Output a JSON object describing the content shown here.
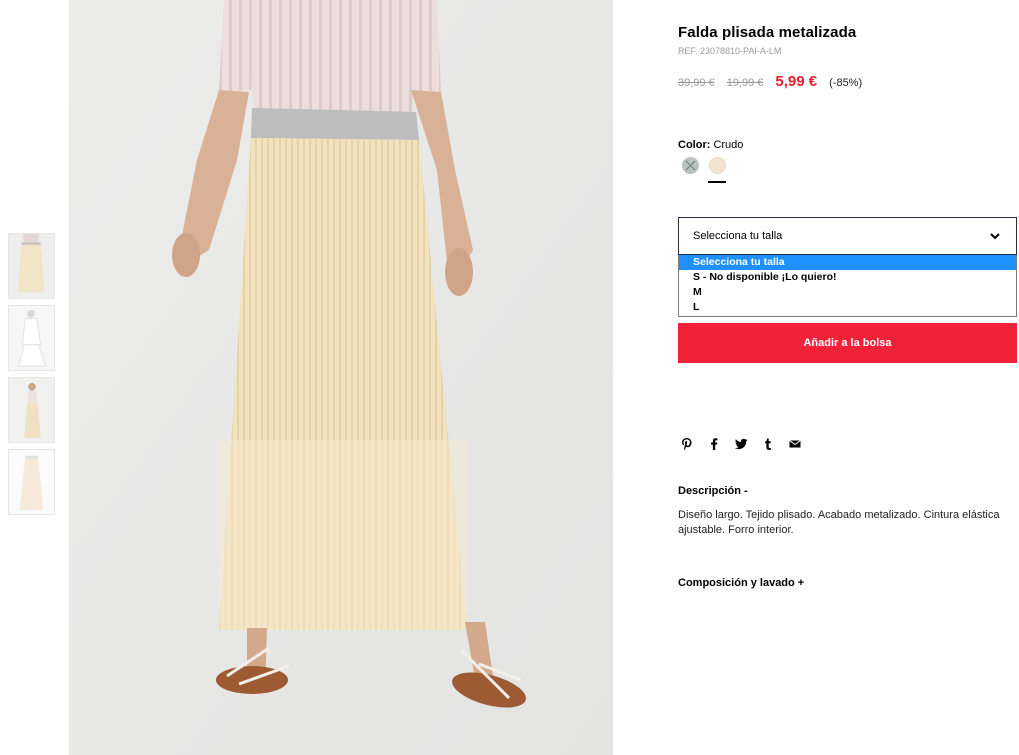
{
  "product": {
    "title": "Falda plisada metalizada",
    "ref": "REF. 23078810-PAI-A-LM",
    "price_original": "39,99 €",
    "price_previous": "19,99 €",
    "price_sale": "5,99 €",
    "discount": "(-85%)"
  },
  "color": {
    "label": "Color:",
    "value": "Crudo",
    "swatches": [
      "grey-pattern",
      "crudo"
    ]
  },
  "size": {
    "placeholder": "Selecciona tu talla",
    "options": [
      "Selecciona tu talla",
      "S - No disponible ¡Lo quiero!",
      "M",
      "L"
    ],
    "highlighted_option": "Selecciona tu talla"
  },
  "actions": {
    "add_to_bag": "Añadir a la bolsa"
  },
  "share_icons": [
    "pinterest-icon",
    "facebook-icon",
    "twitter-icon",
    "tumblr-icon",
    "email-icon"
  ],
  "description": {
    "heading": "Descripción  -",
    "text": "Diseño largo. Tejido plisado. Acabado metalizado. Cintura elástica ajustable. Forro interior."
  },
  "composition": {
    "heading": "Composición y lavado  +"
  },
  "colors": {
    "sale_red": "#e5202e",
    "button_red": "#f1213a",
    "highlight_blue": "#1e90ff"
  }
}
